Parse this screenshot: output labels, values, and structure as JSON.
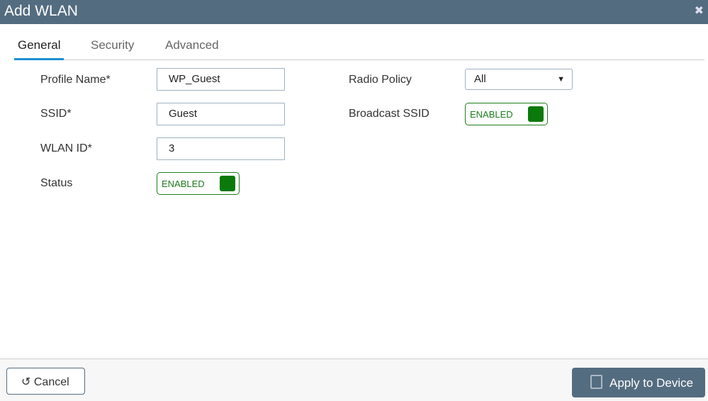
{
  "dialog": {
    "title": "Add WLAN",
    "close_icon": "close-icon"
  },
  "tabs": [
    {
      "label": "General",
      "active": true
    },
    {
      "label": "Security"
    },
    {
      "label": "Advanced"
    }
  ],
  "form": {
    "profile_name": {
      "label": "Profile Name*",
      "value": "WP_Guest"
    },
    "ssid": {
      "label": "SSID*",
      "value": "Guest"
    },
    "wlan_id": {
      "label": "WLAN ID*",
      "value": "3"
    },
    "status": {
      "label": "Status",
      "value": "ENABLED"
    },
    "radio_policy": {
      "label": "Radio Policy",
      "value": "All"
    },
    "broadcast_ssid": {
      "label": "Broadcast SSID",
      "value": "ENABLED"
    }
  },
  "footer": {
    "cancel_label": "Cancel",
    "apply_label": "Apply to Device"
  },
  "colors": {
    "header": "#546c80",
    "enabled": "#0a7a0a",
    "tab_accent": "#1a8fd1"
  }
}
